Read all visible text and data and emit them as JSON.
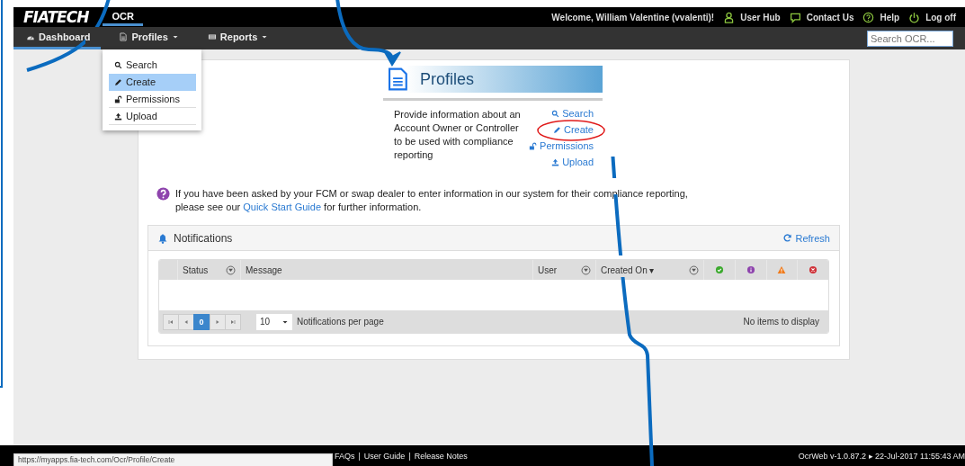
{
  "brand": {
    "logo": "FIATECH",
    "app": "OCR"
  },
  "user_bar": {
    "welcome": "Welcome, William Valentine (vvalenti)!",
    "links": [
      {
        "label": "User Hub",
        "kind": "user"
      },
      {
        "label": "Contact Us",
        "kind": "chat"
      },
      {
        "label": "Help",
        "kind": "help"
      },
      {
        "label": "Log off",
        "kind": "power"
      }
    ]
  },
  "nav": {
    "items": [
      {
        "label": "Dashboard",
        "kind": "dashboard",
        "selected": true,
        "dropdown": false
      },
      {
        "label": "Profiles",
        "kind": "document",
        "selected": false,
        "dropdown": true
      },
      {
        "label": "Reports",
        "kind": "reports",
        "selected": false,
        "dropdown": true
      }
    ],
    "search": {
      "placeholder": "Search OCR..."
    }
  },
  "menu": {
    "items": [
      {
        "label": "Search",
        "kind": "search",
        "selected": false
      },
      {
        "label": "Create",
        "kind": "pencil",
        "selected": true
      },
      {
        "label": "Permissions",
        "kind": "lock",
        "selected": false
      },
      {
        "label": "Upload",
        "kind": "upload",
        "selected": false
      }
    ]
  },
  "profiles": {
    "title": "Profiles",
    "description": "Provide information about an Account Owner or Controller to be used with compliance reporting",
    "links": [
      {
        "label": "Search",
        "kind": "search"
      },
      {
        "label": "Create",
        "kind": "pencil"
      },
      {
        "label": "Permissions",
        "kind": "lock"
      },
      {
        "label": "Upload",
        "kind": "upload"
      }
    ]
  },
  "notice": {
    "line_1": "If you have been asked by your FCM or swap dealer to enter information in our system for their compliance reporting,",
    "line_2": "please see our",
    "link": "Quick Start Guide",
    "tail": "for further information."
  },
  "notifications": {
    "title": "Notifications",
    "refresh": "Refresh",
    "columns": [
      {
        "label": "Status",
        "kind": "text",
        "filter": true
      },
      {
        "label": "Message",
        "kind": "text",
        "filter": false
      },
      {
        "label": "User",
        "kind": "text",
        "filter": true
      },
      {
        "label": "Created On ▾",
        "kind": "text",
        "filter": true
      },
      {
        "kind": "success"
      },
      {
        "kind": "info"
      },
      {
        "kind": "warning"
      },
      {
        "kind": "error"
      }
    ],
    "pager": {
      "page": "0",
      "page_size": "10",
      "per_page": "Notifications per page",
      "empty": "No items to display"
    }
  },
  "footer": {
    "links": [
      "FAQs",
      "User Guide",
      "Release Notes"
    ],
    "separator": "|",
    "version": "OcrWeb v-1.0.87.2 ▸ 22-Jul-2017 11:55:43 AM",
    "status_url": "https://myapps.fia-tech.com/Ocr/Profile/Create"
  },
  "annotations": [
    {
      "kind": "curve"
    },
    {
      "kind": "arrow"
    },
    {
      "kind": "ellipse"
    },
    {
      "kind": "curve"
    },
    {
      "kind": "frame"
    }
  ]
}
